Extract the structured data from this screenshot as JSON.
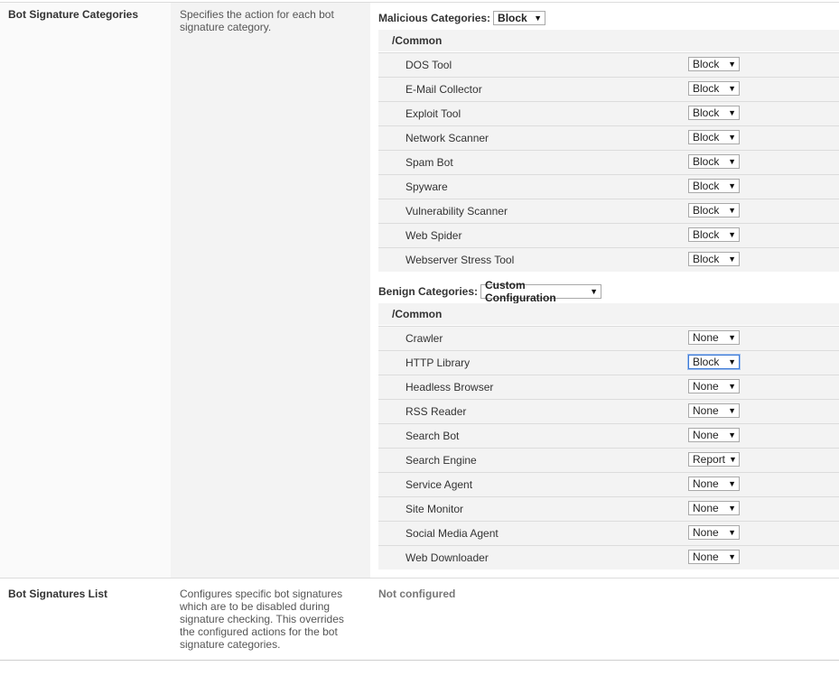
{
  "bot_signature_categories": {
    "label": "Bot Signature Categories",
    "description": "Specifies the action for each bot signature category.",
    "malicious": {
      "header_label": "Malicious Categories:",
      "header_value": "Block",
      "partition": "/Common",
      "items": [
        {
          "name": "DOS Tool",
          "value": "Block"
        },
        {
          "name": "E-Mail Collector",
          "value": "Block"
        },
        {
          "name": "Exploit Tool",
          "value": "Block"
        },
        {
          "name": "Network Scanner",
          "value": "Block"
        },
        {
          "name": "Spam Bot",
          "value": "Block"
        },
        {
          "name": "Spyware",
          "value": "Block"
        },
        {
          "name": "Vulnerability Scanner",
          "value": "Block"
        },
        {
          "name": "Web Spider",
          "value": "Block"
        },
        {
          "name": "Webserver Stress Tool",
          "value": "Block"
        }
      ]
    },
    "benign": {
      "header_label": "Benign Categories:",
      "header_value": "Custom Configuration",
      "partition": "/Common",
      "items": [
        {
          "name": "Crawler",
          "value": "None"
        },
        {
          "name": "HTTP Library",
          "value": "Block"
        },
        {
          "name": "Headless Browser",
          "value": "None"
        },
        {
          "name": "RSS Reader",
          "value": "None"
        },
        {
          "name": "Search Bot",
          "value": "None"
        },
        {
          "name": "Search Engine",
          "value": "Report"
        },
        {
          "name": "Service Agent",
          "value": "None"
        },
        {
          "name": "Site Monitor",
          "value": "None"
        },
        {
          "name": "Social Media Agent",
          "value": "None"
        },
        {
          "name": "Web Downloader",
          "value": "None"
        }
      ]
    }
  },
  "bot_signatures_list": {
    "label": "Bot Signatures List",
    "description": "Configures specific bot signatures which are to be disabled during signature checking. This overrides the configured actions for the bot signature categories.",
    "status": "Not configured"
  },
  "dropdown_arrow": "▼",
  "colors": {
    "focus_border": "#3d7ad6",
    "row_bg": "#f3f3f3",
    "border": "#dcdcdc"
  }
}
